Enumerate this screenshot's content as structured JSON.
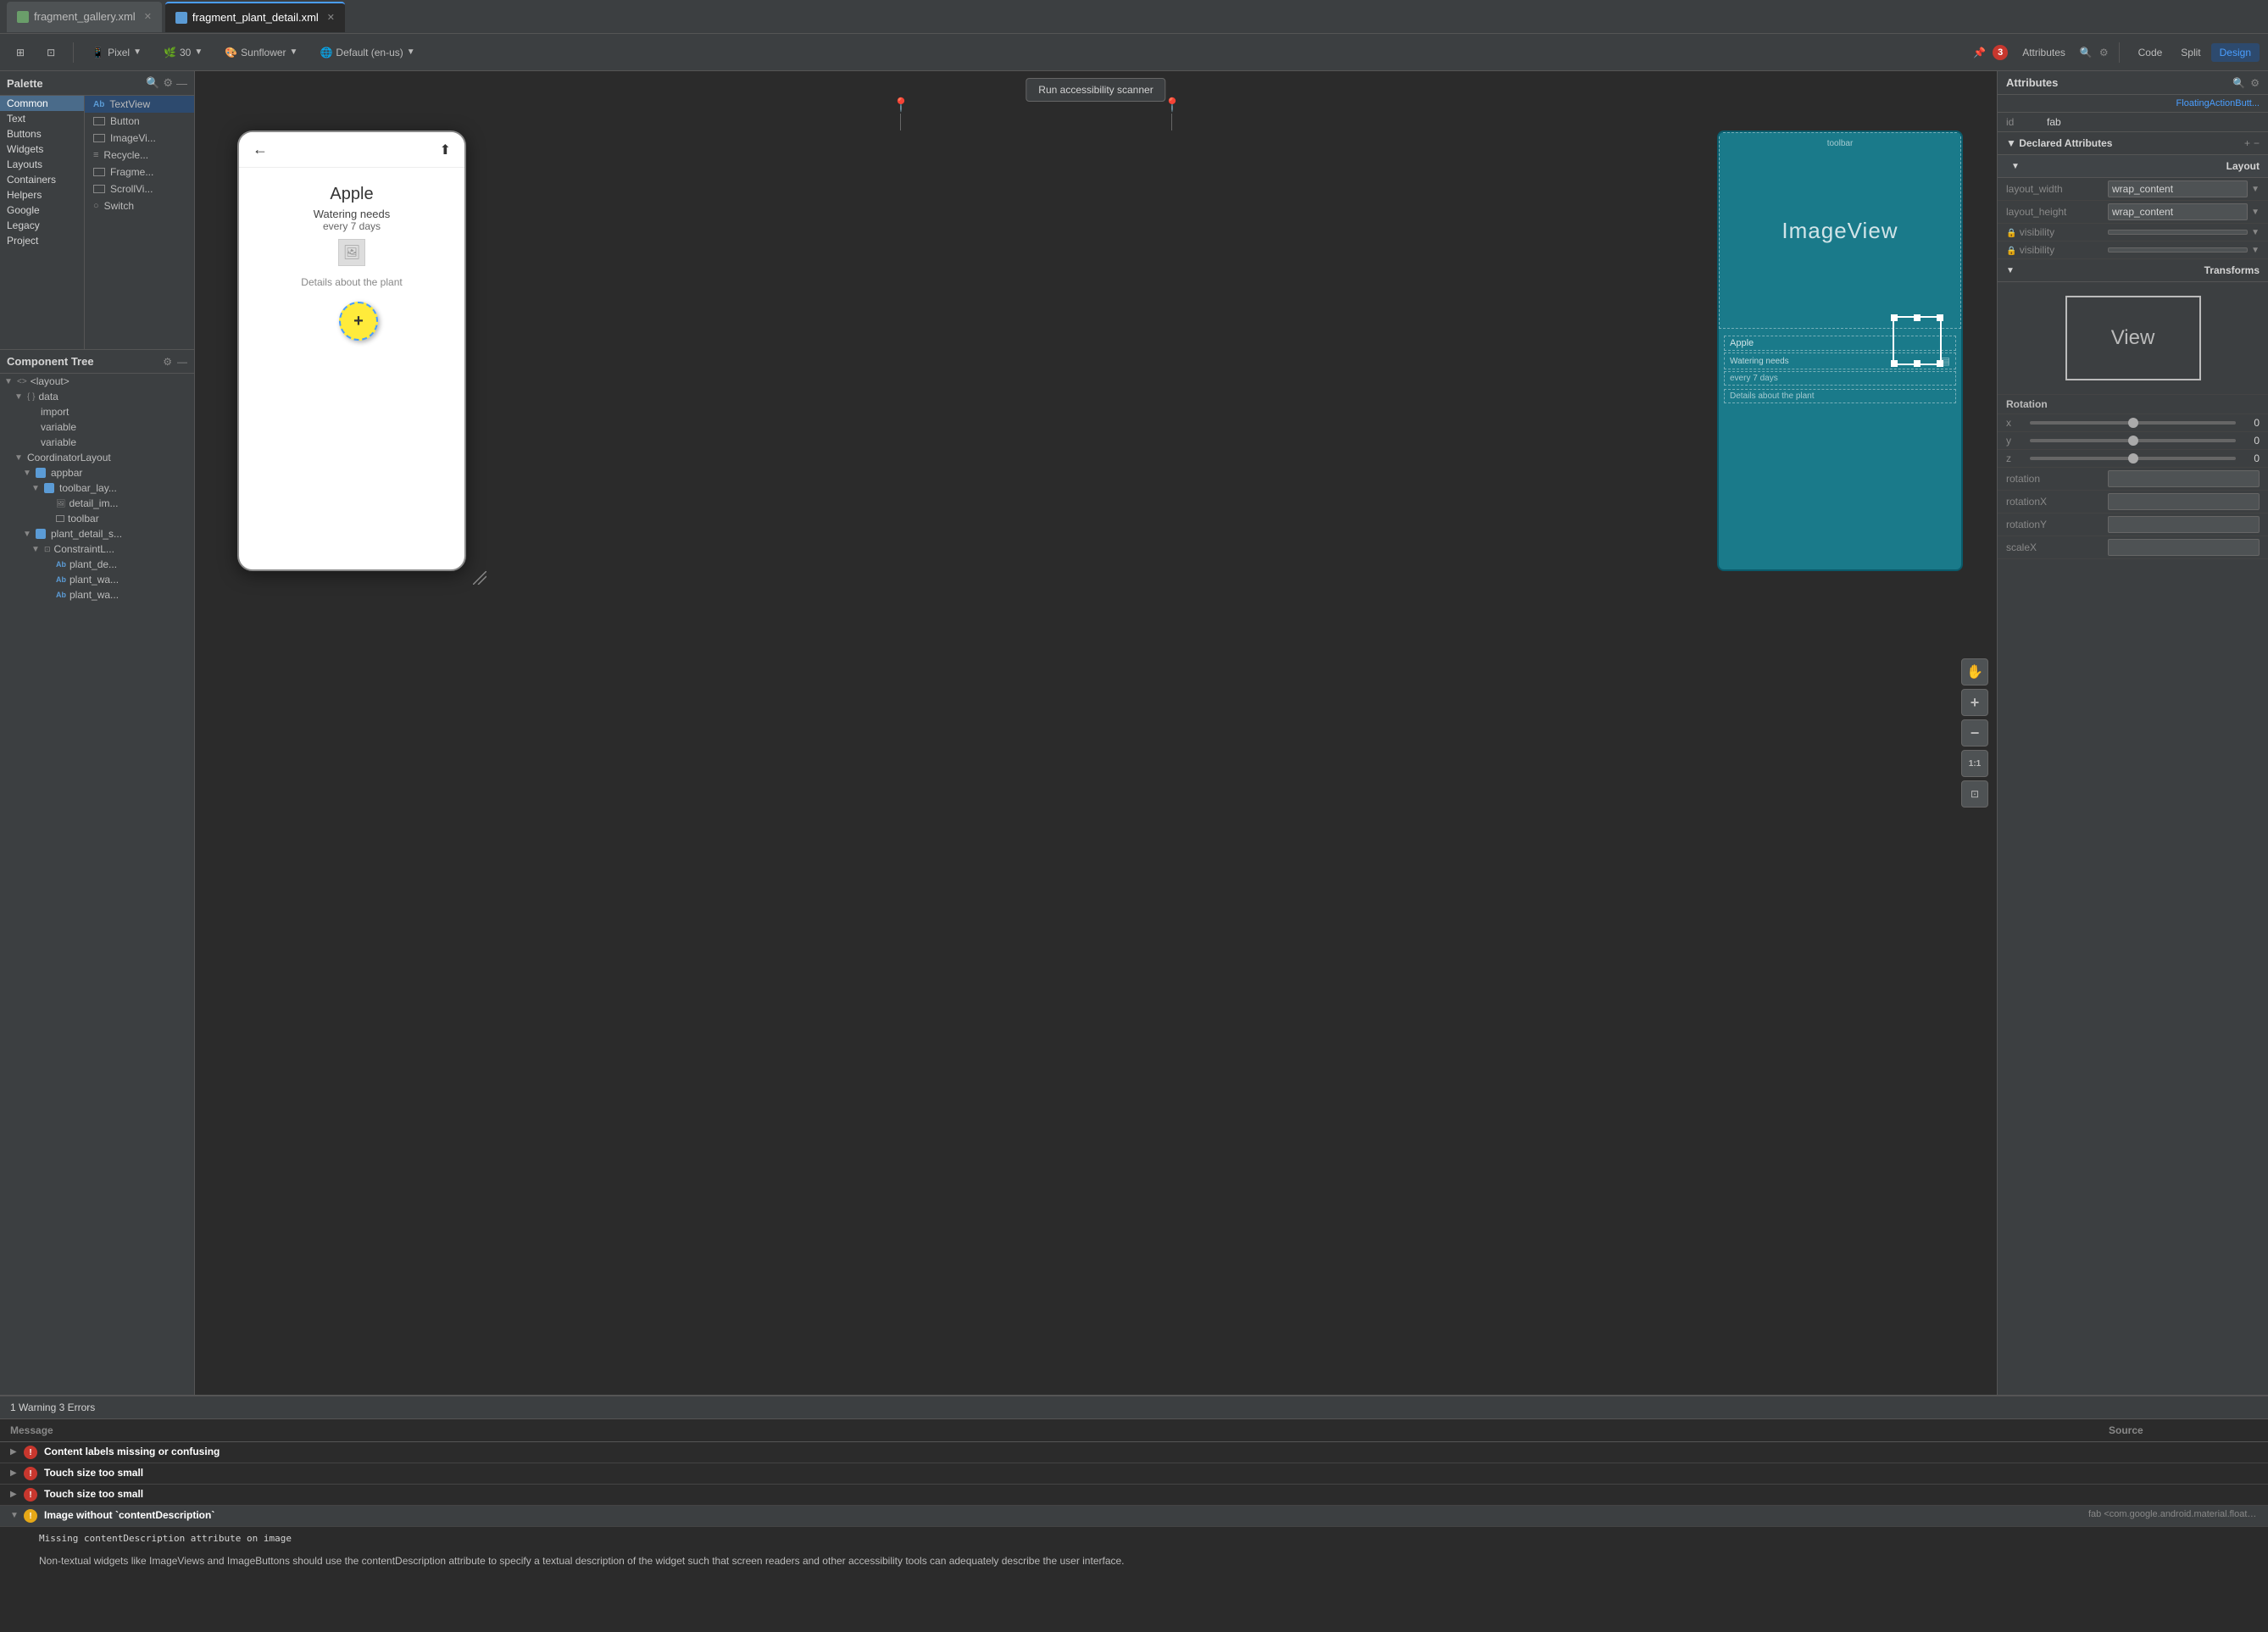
{
  "tabs": [
    {
      "id": "gallery",
      "label": "fragment_gallery.xml",
      "active": false,
      "icon": "xml"
    },
    {
      "id": "plant_detail",
      "label": "fragment_plant_detail.xml",
      "active": true,
      "icon": "xml"
    }
  ],
  "top_toolbar": {
    "palette_btn": "Palette",
    "code_btn": "Code",
    "split_btn": "Split",
    "design_btn": "Design",
    "device": "Pixel",
    "api_level": "30",
    "theme": "Sunflower",
    "locale": "Default (en-us)",
    "pin_icon1": "📌",
    "pin_icon2": "📌",
    "attr_btn": "Attributes",
    "warning_count": "1",
    "error_count": "3"
  },
  "palette": {
    "title": "Palette",
    "search_placeholder": "Search",
    "categories": [
      {
        "id": "common",
        "label": "Common",
        "active": true
      },
      {
        "id": "text",
        "label": "Text"
      },
      {
        "id": "buttons",
        "label": "Buttons"
      },
      {
        "id": "widgets",
        "label": "Widgets"
      },
      {
        "id": "layouts",
        "label": "Layouts"
      },
      {
        "id": "containers",
        "label": "Containers"
      },
      {
        "id": "helpers",
        "label": "Helpers"
      },
      {
        "id": "google",
        "label": "Google"
      },
      {
        "id": "legacy",
        "label": "Legacy"
      },
      {
        "id": "project",
        "label": "Project"
      }
    ],
    "selected_item": "TextView",
    "common_items": [
      {
        "id": "textview",
        "label": "TextView",
        "icon": "Ab",
        "type": "text"
      },
      {
        "id": "button",
        "label": "Button",
        "icon": "□",
        "type": "widget"
      },
      {
        "id": "imageview",
        "label": "ImageVi...",
        "icon": "□",
        "type": "image"
      },
      {
        "id": "recyclerview",
        "label": "Recycle...",
        "icon": "≡",
        "type": "list"
      },
      {
        "id": "fragmentcontainer",
        "label": "Fragme...",
        "icon": "□",
        "type": "container"
      },
      {
        "id": "scrollview",
        "label": "ScrollVi...",
        "icon": "□",
        "type": "scroll"
      },
      {
        "id": "switch",
        "label": "Switch",
        "icon": "○",
        "type": "toggle"
      }
    ]
  },
  "component_tree": {
    "title": "Component Tree",
    "items": [
      {
        "id": "layout",
        "label": "<layout>",
        "indent": 0,
        "type": "layout",
        "expanded": true
      },
      {
        "id": "data",
        "label": "data",
        "indent": 1,
        "type": "data",
        "expanded": true
      },
      {
        "id": "import",
        "label": "import",
        "indent": 2,
        "type": "import"
      },
      {
        "id": "variable1",
        "label": "variable",
        "indent": 2,
        "type": "variable"
      },
      {
        "id": "variable2",
        "label": "variable",
        "indent": 2,
        "type": "variable"
      },
      {
        "id": "coordinatorlayout",
        "label": "CoordinatorLayout",
        "indent": 1,
        "type": "layout",
        "expanded": true
      },
      {
        "id": "appbar",
        "label": "appbar",
        "indent": 2,
        "type": "appbar",
        "expanded": true
      },
      {
        "id": "toolbar_lay",
        "label": "toolbar_lay...",
        "indent": 3,
        "type": "file",
        "expanded": true
      },
      {
        "id": "detail_im",
        "label": "detail_im...",
        "indent": 4,
        "type": "image"
      },
      {
        "id": "toolbar",
        "label": "toolbar",
        "indent": 4,
        "type": "toolbar"
      },
      {
        "id": "plant_detail_s",
        "label": "plant_detail_s...",
        "indent": 2,
        "type": "file",
        "expanded": true
      },
      {
        "id": "constraintl",
        "label": "ConstraintL...",
        "indent": 3,
        "type": "constraint",
        "expanded": true
      },
      {
        "id": "plant_de",
        "label": "plant_de...",
        "indent": 4,
        "type": "textview"
      },
      {
        "id": "plant_wa1",
        "label": "plant_wa...",
        "indent": 4,
        "type": "textview"
      },
      {
        "id": "plant_wa2",
        "label": "plant_wa...",
        "indent": 4,
        "type": "textview"
      }
    ]
  },
  "canvas": {
    "scanner_btn": "Run accessibility scanner",
    "phone_preview": {
      "plant_name": "Apple",
      "watering_label": "Watering needs",
      "watering_freq": "every 7 days",
      "details": "Details about the plant",
      "fab_icon": "+"
    },
    "blueprint": {
      "imageview_label": "ImageView",
      "apple_label": "Apple",
      "watering_label": "Watering needs",
      "freq_label": "every 7 days",
      "details_label": "Details about the plant"
    }
  },
  "attributes": {
    "title": "Attributes",
    "fab_label": "FloatingActionButt...",
    "id_label": "id",
    "id_value": "fab",
    "declared_section": "Declared Attributes",
    "layout_section": "Layout",
    "transforms_section": "Transforms",
    "layout_width_label": "layout_width",
    "layout_width_value": "wrap_content",
    "layout_height_label": "layout_height",
    "layout_height_value": "wrap_content",
    "visibility_label": "visibility",
    "visibility_value": "",
    "visibility2_label": "visibility",
    "visibility2_value": "",
    "rotation_label": "Rotation",
    "x_label": "x",
    "y_label": "y",
    "z_label": "z",
    "x_value": "0",
    "y_value": "0",
    "z_value": "0",
    "rotation_input_label": "rotation",
    "rotationX_label": "rotationX",
    "rotationY_label": "rotationY",
    "scaleX_label": "scaleX"
  },
  "bottom_panel": {
    "title": "1 Warning 3 Errors",
    "col_message": "Message",
    "col_source": "Source",
    "errors": [
      {
        "id": "content_labels",
        "type": "error",
        "message": "Content labels missing or confusing",
        "source": "",
        "expanded": false
      },
      {
        "id": "touch_size1",
        "type": "error",
        "message": "Touch size too small",
        "source": "",
        "expanded": false
      },
      {
        "id": "touch_size2",
        "type": "error",
        "message": "Touch size too small",
        "source": "",
        "expanded": false
      },
      {
        "id": "image_no_content_desc",
        "type": "warning",
        "message": "Image without `contentDescription`",
        "source": "fab <com.google.android.material.floatingactionbutton.FloatingActionButton>",
        "expanded": true,
        "detail_line1": "Missing contentDescription attribute on image",
        "detail_line2": "Non-textual widgets like ImageViews and ImageButtons should use the contentDescription attribute to specify a textual description of the widget such that screen readers and other accessibility tools can adequately describe the user interface."
      }
    ]
  }
}
